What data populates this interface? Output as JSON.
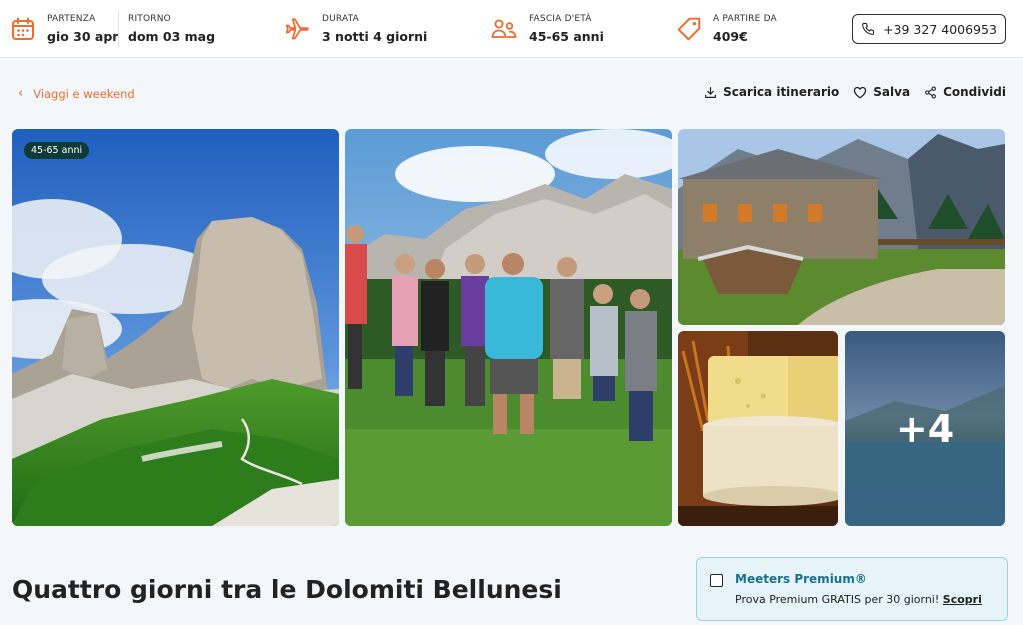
{
  "topbar": {
    "departure": {
      "label": "PARTENZA",
      "value": "gio 30 apr",
      "icon": "calendar-icon"
    },
    "return": {
      "label": "RITORNO",
      "value": "dom 03 mag"
    },
    "duration": {
      "label": "DURATA",
      "value": "3 notti 4 giorni",
      "icon": "airplane-icon"
    },
    "age_range": {
      "label": "FASCIA D'ETÀ",
      "value": "45-65 anni",
      "icon": "people-icon"
    },
    "price": {
      "label": "A PARTIRE DA",
      "value": "409€",
      "icon": "price-tag-icon"
    },
    "phone": {
      "value": "+39 327 4006953",
      "icon": "phone-icon"
    },
    "accent_color": "#ef6b2e"
  },
  "breadcrumb": {
    "label": "Viaggi e weekend"
  },
  "actions": {
    "download": "Scarica itinerario",
    "save": "Salva",
    "share": "Condividi"
  },
  "gallery": {
    "age_badge": "45-65 anni",
    "more_count": "+4"
  },
  "trip_title": "Quattro giorni tra le Dolomiti Bellunesi",
  "premium": {
    "title": "Meeters Premium®",
    "text": "Prova Premium GRATIS per 30 giorni!",
    "link": "Scopri",
    "color": "#1a6f8c"
  }
}
